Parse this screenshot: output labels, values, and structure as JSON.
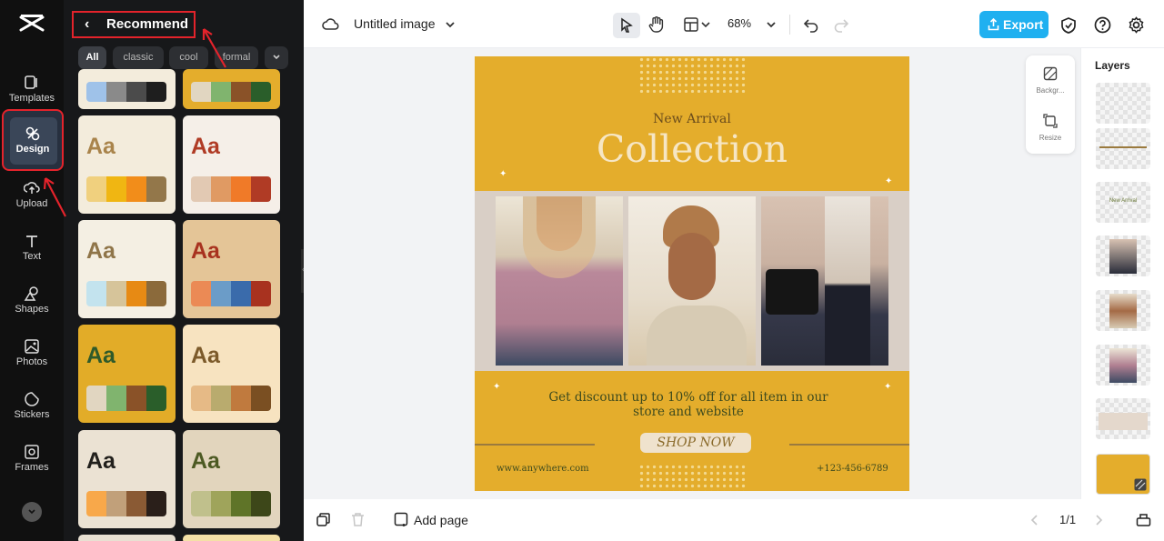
{
  "app": {
    "title": "Untitled image",
    "zoom": "68%",
    "export_label": "Export",
    "page_indicator": "1/1",
    "add_page_label": "Add page"
  },
  "sidebar": {
    "items": [
      {
        "label": "Templates",
        "icon": "templates-icon"
      },
      {
        "label": "Design",
        "icon": "design-icon",
        "active": true
      },
      {
        "label": "Upload",
        "icon": "upload-icon"
      },
      {
        "label": "Text",
        "icon": "text-icon"
      },
      {
        "label": "Shapes",
        "icon": "shapes-icon"
      },
      {
        "label": "Photos",
        "icon": "photos-icon"
      },
      {
        "label": "Stickers",
        "icon": "stickers-icon"
      },
      {
        "label": "Frames",
        "icon": "frames-icon"
      }
    ]
  },
  "panel": {
    "header": "Recommend",
    "chips": [
      "All",
      "classic",
      "cool",
      "formal"
    ],
    "sample_text": "Aa",
    "cards": [
      {
        "bg": "#f3ecdc",
        "text": "#a9844b",
        "colors": [
          "#f0d07e",
          "#f0b612",
          "#f28d1a",
          "#93774a"
        ]
      },
      {
        "bg": "#f5efe8",
        "text": "#b03b25",
        "colors": [
          "#e2c9b3",
          "#e09a63",
          "#f07a28",
          "#b03b25"
        ]
      },
      {
        "bg": "#f4efe3",
        "text": "#8f7549",
        "colors": [
          "#c3e3ee",
          "#d6c49a",
          "#e78a14",
          "#8b6a3b"
        ]
      },
      {
        "bg": "#e4c597",
        "text": "#a8321f",
        "colors": [
          "#eb8a55",
          "#6b9cc8",
          "#3a6bab",
          "#a8321f"
        ]
      },
      {
        "bg": "#e2ac28",
        "text": "#2f5a2a",
        "colors": [
          "#e1d6c1",
          "#80b46e",
          "#8a5228",
          "#2a5e2a"
        ]
      },
      {
        "bg": "#f7e3c0",
        "text": "#7c5a2a",
        "colors": [
          "#e6ba86",
          "#b9ab6e",
          "#c07a3e",
          "#7a4f22"
        ]
      },
      {
        "bg": "#ebe2d3",
        "text": "#22201c",
        "colors": [
          "#f8a84a",
          "#c1a07a",
          "#8a5a34",
          "#2a1f1a"
        ]
      },
      {
        "bg": "#e2d5bd",
        "text": "#4d5a23",
        "colors": [
          "#c0c08c",
          "#9fa45b",
          "#5f7428",
          "#3d4719"
        ]
      }
    ]
  },
  "toolbar": {
    "cloud_icon": "cloud-icon",
    "undo_icon": "undo-icon",
    "redo_icon": "redo-icon"
  },
  "float_panel": {
    "background_label": "Backgr...",
    "resize_label": "Resize"
  },
  "layers": {
    "title": "Layers",
    "thumb_new_arrival": "New Arrival"
  },
  "design": {
    "subtitle": "New Arrival",
    "title": "Collection",
    "discount_line1": "Get discount up to 10% off for all item in our",
    "discount_line2": "store and website",
    "cta": "SHOP NOW",
    "website": "www.anywhere.com",
    "phone": "+123-456-6789",
    "bg_color": "#e4ad2c"
  }
}
